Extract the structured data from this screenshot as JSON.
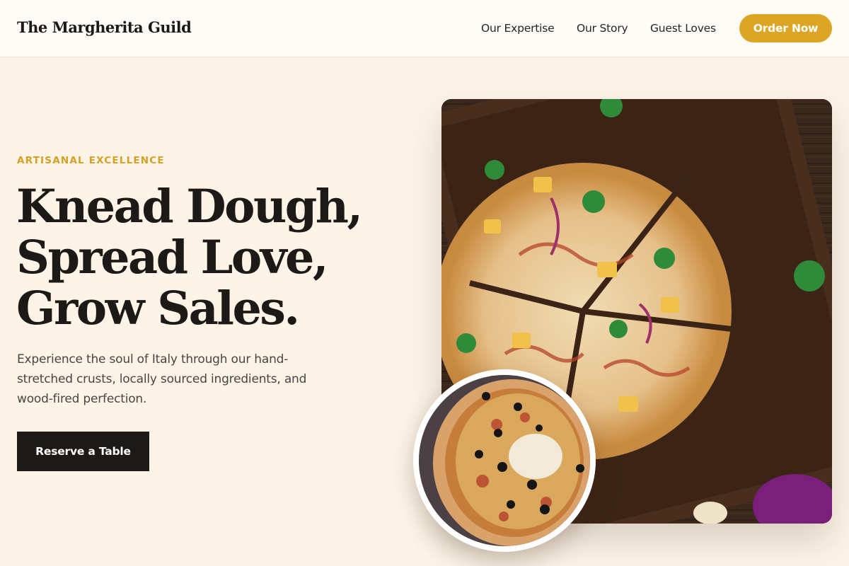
{
  "brand": {
    "name": "The Margherita Guild"
  },
  "nav": {
    "links": [
      "Our Expertise",
      "Our Story",
      "Guest Loves"
    ],
    "cta": "Order Now"
  },
  "hero": {
    "eyebrow": "ARTISANAL EXCELLENCE",
    "headline": [
      "Knead Dough,",
      "Spread Love,",
      "Grow Sales."
    ],
    "description": "Experience the soul of Italy through our hand-stretched crusts, locally sourced ingredients, and wood-fired perfection.",
    "cta": "Reserve a Table"
  },
  "images": {
    "main": "bbq-chicken-pizza-on-wooden-board",
    "inset": "olive-pizza-closeup"
  },
  "colors": {
    "background": "#fdf4e7",
    "accent": "#dca624",
    "dark": "#1c1917"
  }
}
